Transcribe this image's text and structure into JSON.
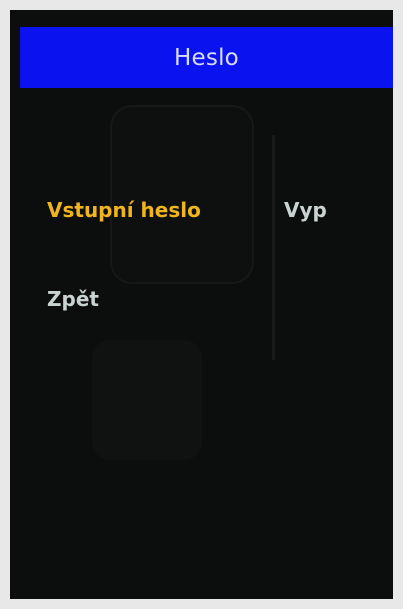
{
  "header": {
    "title": "Heslo"
  },
  "menu": {
    "items": [
      {
        "label": "Vstupní heslo",
        "value": "Vyp",
        "selected": true
      },
      {
        "label": "Zpět",
        "selected": false
      }
    ]
  },
  "colors": {
    "header_background": "#0a12f0",
    "selected_text": "#f0b51c",
    "normal_text": "#c9d4d2",
    "screen_background": "#0c0e0e"
  }
}
